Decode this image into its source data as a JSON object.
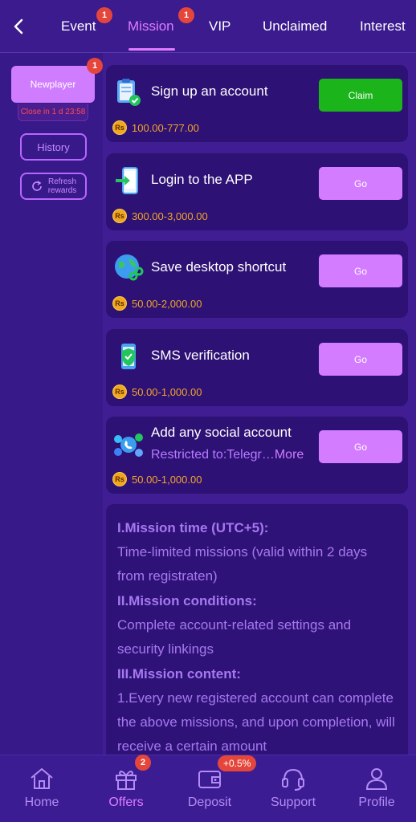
{
  "header": {
    "tabs": [
      {
        "label": "Event",
        "badge": "1"
      },
      {
        "label": "Mission",
        "badge": "1",
        "active": true
      },
      {
        "label": "VIP"
      },
      {
        "label": "Unclaimed"
      },
      {
        "label": "Interest"
      }
    ]
  },
  "sidebar": {
    "newplayer_label": "Newplayer",
    "newplayer_badge": "1",
    "countdown": "Close in 1 d 23:58",
    "history_label": "History",
    "refresh_label_1": "Refresh",
    "refresh_label_2": "rewards"
  },
  "currency_symbol": "Rs",
  "missions": [
    {
      "title": "Sign up an account",
      "reward": "100.00-777.00",
      "action": "Claim",
      "icon": "clipboard-check-icon"
    },
    {
      "title": "Login to the APP",
      "reward": "300.00-3,000.00",
      "action": "Go",
      "icon": "phone-login-icon"
    },
    {
      "title": "Save desktop shortcut",
      "reward": "50.00-2,000.00",
      "action": "Go",
      "icon": "globe-link-icon"
    },
    {
      "title": "SMS verification",
      "reward": "50.00-1,000.00",
      "action": "Go",
      "icon": "shield-phone-icon"
    },
    {
      "title": "Add any social account",
      "subtitle": "Restricted to:Telegr…",
      "more": "More",
      "reward": "50.00-1,000.00",
      "action": "Go",
      "icon": "social-network-icon"
    }
  ],
  "rules": {
    "h1": "I.Mission time (UTC+5):",
    "p1": "Time-limited missions (valid within 2 days from registraten)",
    "h2": "II.Mission conditions:",
    "p2": "Complete account-related settings and security linkings",
    "h3": "III.Mission content:",
    "p3": "1.Every new registered account can complete the above missions, and upon completion, will receive a certain amount"
  },
  "bottom_nav": {
    "items": [
      {
        "label": "Home",
        "icon": "home-icon"
      },
      {
        "label": "Offers",
        "icon": "gift-icon",
        "active": true
      },
      {
        "label": "Deposit",
        "icon": "wallet-icon"
      },
      {
        "label": "Support",
        "icon": "headset-icon"
      },
      {
        "label": "Profile",
        "icon": "user-icon"
      }
    ],
    "offers_badge": "2",
    "deposit_badge": "+0.5%"
  },
  "colors": {
    "background": "#3b1a8c",
    "accent": "#e07cff",
    "claim_green": "#1bb51b",
    "go_purple": "#d47cff",
    "reward_gold": "#f3a527",
    "badge_red": "#e5463b"
  }
}
